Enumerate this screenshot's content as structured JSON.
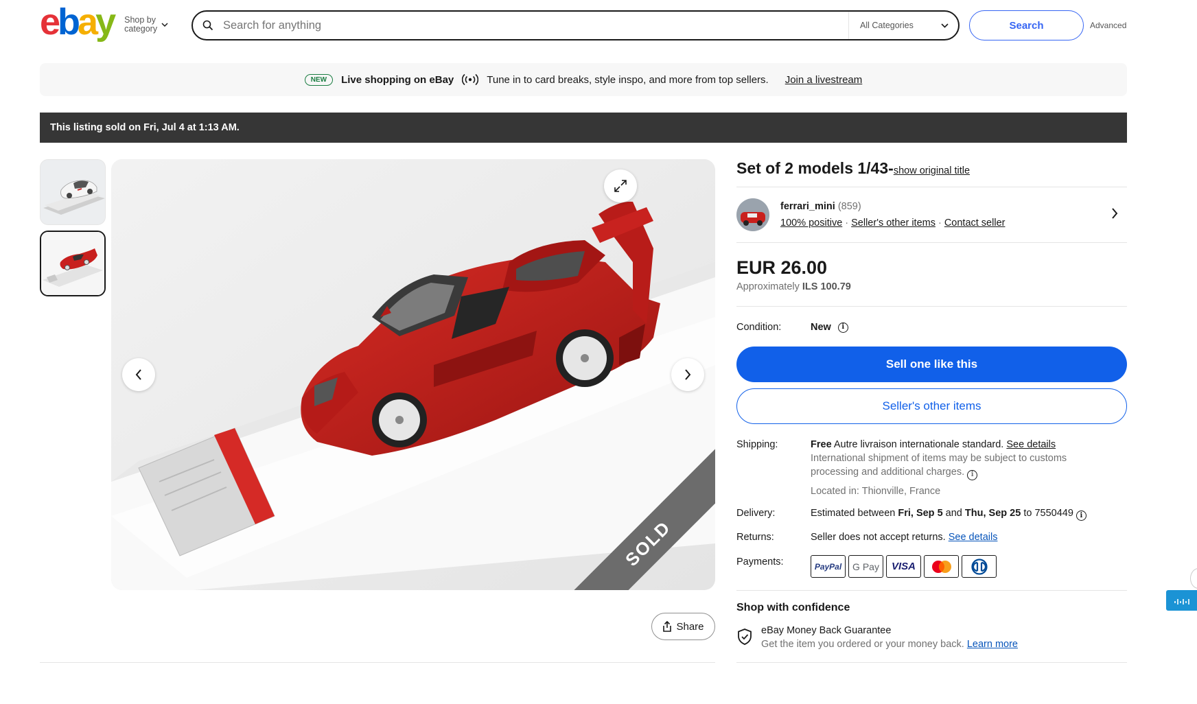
{
  "header": {
    "shop_by_line1": "Shop by",
    "shop_by_line2": "category",
    "search_placeholder": "Search for anything",
    "category_select": "All Categories",
    "search_button": "Search",
    "advanced_link": "Advanced"
  },
  "promo": {
    "badge": "NEW",
    "title": "Live shopping on eBay",
    "text": "Tune in to card breaks, style inspo, and more from top sellers.",
    "link": "Join a livestream"
  },
  "sold_banner": "This listing sold on Fri, Jul 4 at 1:13 AM.",
  "gallery": {
    "sold_ribbon": "SOLD",
    "share_label": "Share"
  },
  "listing": {
    "title": "Set of 2 models 1/43-",
    "show_original_title": "show original title",
    "seller": {
      "name": "ferrari_mini",
      "feedback_count": "(859)",
      "positive": "100% positive",
      "other_items_link": "Seller's other items",
      "contact_link": "Contact seller",
      "separator": "·"
    },
    "price": "EUR 26.00",
    "approx_label": "Approximately",
    "approx_value": "ILS 100.79",
    "condition_label": "Condition:",
    "condition_value": "New",
    "sell_button": "Sell one like this",
    "seller_items_button": "Seller's other items",
    "shipping": {
      "label": "Shipping:",
      "free": "Free",
      "service": "Autre livraison internationale standard.",
      "see_details": "See details",
      "note_line1": "International shipment of items may be subject to customs",
      "note_line2": "processing and additional charges.",
      "located": "Located in: Thionville, France"
    },
    "delivery": {
      "label": "Delivery:",
      "prefix": "Estimated between",
      "start": "Fri, Sep 5",
      "and": "and",
      "end": "Thu, Sep 25",
      "to": "to 7550449"
    },
    "returns": {
      "label": "Returns:",
      "text": "Seller does not accept returns.",
      "link": "See details"
    },
    "payments": {
      "label": "Payments:",
      "methods": [
        "PayPal",
        "G Pay",
        "VISA",
        "Mastercard",
        "Diners Club"
      ]
    },
    "confidence": {
      "title": "Shop with confidence",
      "guarantee_title": "eBay Money Back Guarantee",
      "guarantee_text": "Get the item you ordered or your money back.",
      "learn_more": "Learn more"
    }
  },
  "colors": {
    "ebay_red": "#e53238",
    "ebay_blue": "#0064d2",
    "ebay_yellow": "#f5af02",
    "ebay_green": "#86b817",
    "primary_button": "#1160e9",
    "sold_bar": "#363636"
  }
}
